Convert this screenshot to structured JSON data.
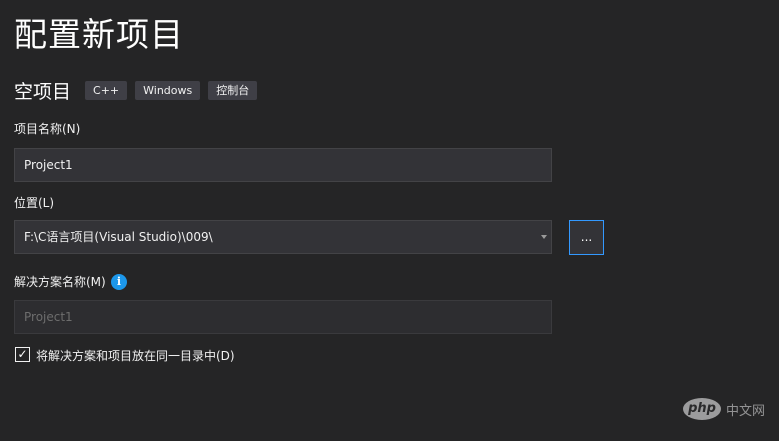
{
  "page": {
    "title": "配置新项目"
  },
  "template": {
    "name": "空项目",
    "tags": [
      "C++",
      "Windows",
      "控制台"
    ]
  },
  "project_name": {
    "label": "项目名称(N)",
    "value": "Project1"
  },
  "location": {
    "label": "位置(L)",
    "value": "F:\\C语言项目(Visual Studio)\\009\\",
    "browse_label": "..."
  },
  "solution_name": {
    "label": "解决方案名称(M)",
    "value": "Project1",
    "info_glyph": "i"
  },
  "same_directory": {
    "checked": true,
    "check_glyph": "✓",
    "label": "将解决方案和项目放在同一目录中(D)"
  },
  "watermark": {
    "logo_text": "php",
    "text": "中文网"
  },
  "colors": {
    "background": "#252526",
    "field": "#333337",
    "accent": "#3399ff",
    "info": "#1c97ea"
  }
}
